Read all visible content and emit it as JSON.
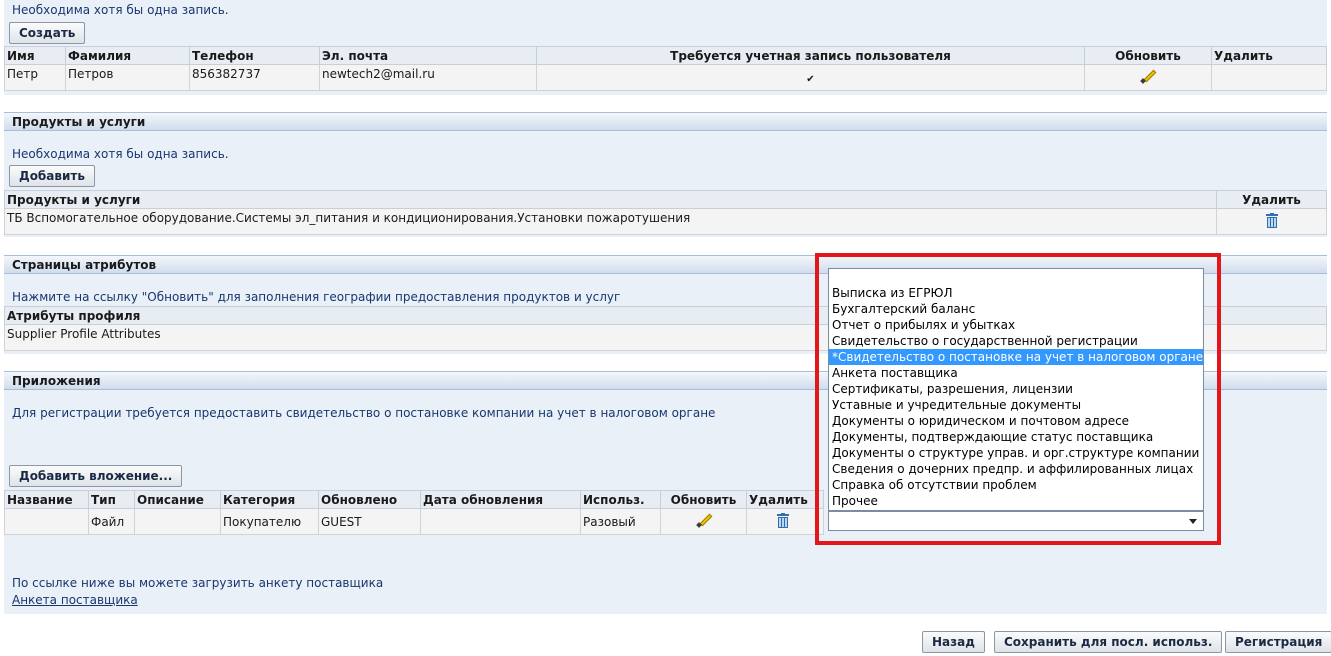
{
  "contacts": {
    "info": "Необходима хотя бы одна запись.",
    "create_button": "Создать",
    "columns": {
      "first_name": "Имя",
      "last_name": "Фамилия",
      "phone": "Телефон",
      "email": "Эл. почта",
      "account_required": "Требуется учетная запись пользователя",
      "update": "Обновить",
      "delete": "Удалить"
    },
    "rows": [
      {
        "first_name": "Петр",
        "last_name": "Петров",
        "phone": "856382737",
        "email": "newtech2@mail.ru",
        "account_required_mark": "✔"
      }
    ]
  },
  "products": {
    "title": "Продукты и услуги",
    "info": "Необходима хотя бы одна запись.",
    "add_button": "Добавить",
    "columns": {
      "name": "Продукты и услуги",
      "delete": "Удалить"
    },
    "rows": [
      {
        "name": "ТБ Вспомогательное оборудование.Системы эл_питания и кондиционирования.Установки пожаротушения"
      }
    ]
  },
  "attributes": {
    "title": "Страницы атрибутов",
    "info": "Нажмите на ссылку \"Обновить\" для заполнения географии предоставления продуктов и услуг",
    "column": "Атрибуты профиля",
    "row": "Supplier Profile Attributes"
  },
  "attachments": {
    "title": "Приложения",
    "info": "Для регистрации требуется предоставить свидетельство о постановке компании на учет в налоговом органе",
    "add_button": "Добавить вложение...",
    "columns": {
      "name": "Название",
      "type": "Тип",
      "description": "Описание",
      "category": "Категория",
      "updated_by": "Обновлено",
      "update_date": "Дата обновления",
      "usage": "Использ.",
      "update": "Обновить",
      "delete": "Удалить"
    },
    "rows": [
      {
        "name": "",
        "type": "Файл",
        "description": "",
        "category": "Покупателю",
        "updated_by": "GUEST",
        "update_date": "",
        "usage": "Разовый"
      }
    ],
    "category_dropdown": {
      "selected_value": "",
      "options": [
        "",
        "Выписка из ЕГРЮЛ",
        "Бухгалтерский баланс",
        "Отчет о прибылях и убытках",
        "Свидетельство о государственной регистрации",
        "*Свидетельство о постановке на учет в налоговом органе",
        "Анкета поставщика",
        "Сертификаты, разрешения, лицензии",
        "Уставные и учредительные документы",
        "Документы о юридическом и почтовом адресе",
        "Документы, подтверждающие статус поставщика",
        "Документы о структуре управ. и орг.структуре компании",
        "Сведения о дочерних предпр. и аффилированных лицах",
        "Справка об отсутствии проблем",
        "Прочее"
      ],
      "highlighted_option": "*Свидетельство о постановке на учет в налоговом органе"
    }
  },
  "footer": {
    "info": "По ссылке ниже вы можете загрузить анкету поставщика",
    "link": "Анкета поставщика"
  },
  "buttons": {
    "back": "Назад",
    "save": "Сохранить для посл. использ.",
    "register": "Регистрация"
  },
  "colors": {
    "panel": "#eaf0f8",
    "info_text": "#17376e",
    "highlight_box": "#e3161c",
    "selected_option": "#3399ff"
  }
}
